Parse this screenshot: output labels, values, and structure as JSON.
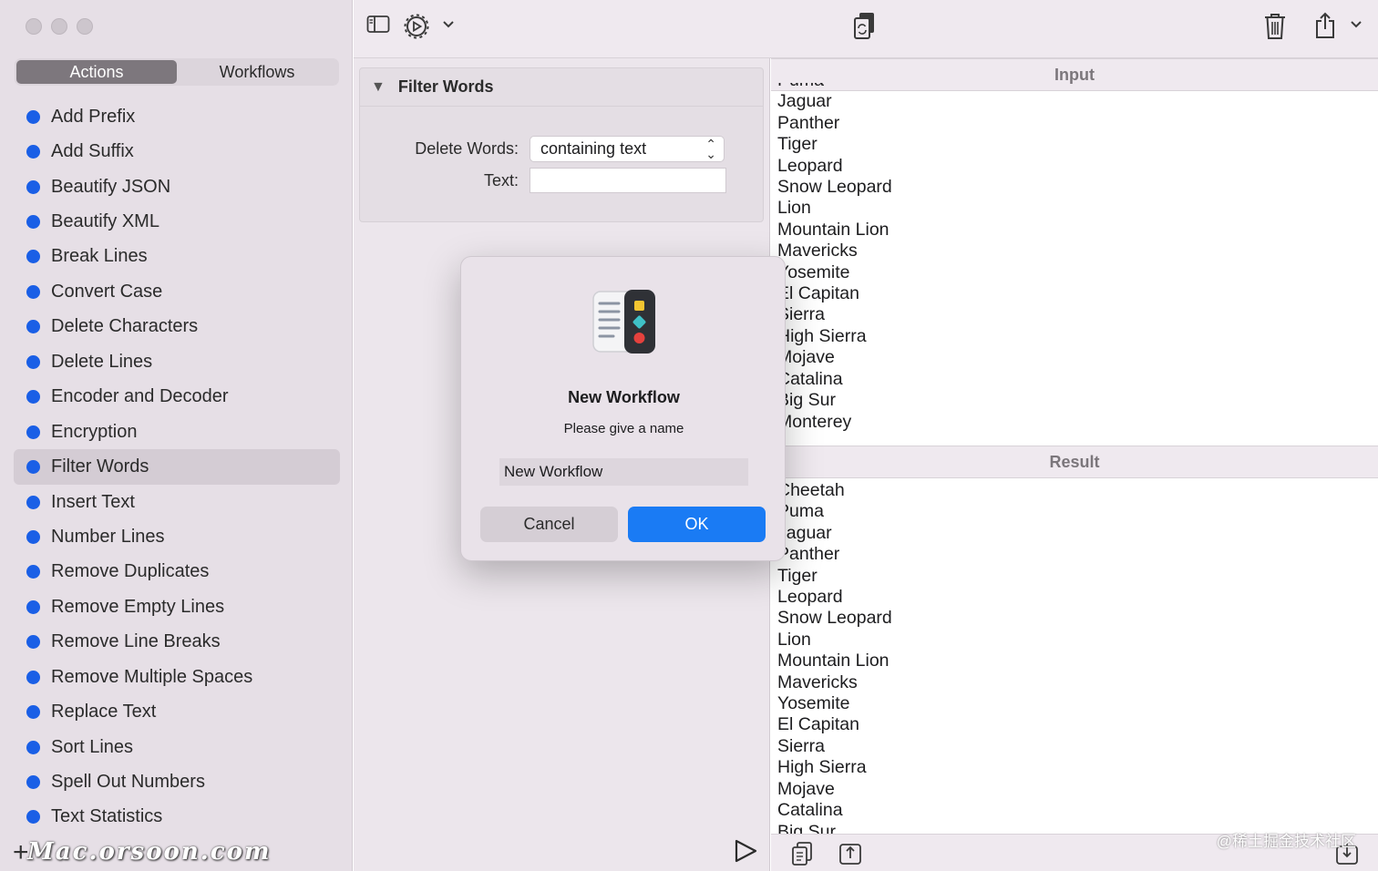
{
  "sidebar": {
    "tabs": [
      {
        "label": "Actions",
        "active": true
      },
      {
        "label": "Workflows",
        "active": false
      }
    ],
    "actions": [
      "Add Prefix",
      "Add Suffix",
      "Beautify JSON",
      "Beautify XML",
      "Break Lines",
      "Convert Case",
      "Delete Characters",
      "Delete Lines",
      "Encoder and Decoder",
      "Encryption",
      "Filter Words",
      "Insert Text",
      "Number Lines",
      "Remove Duplicates",
      "Remove Empty Lines",
      "Remove Line Breaks",
      "Remove Multiple Spaces",
      "Replace Text",
      "Sort Lines",
      "Spell Out Numbers",
      "Text Statistics"
    ],
    "selected_action": "Filter Words",
    "add_label": "+",
    "watermark": "Mac.orsoon.com"
  },
  "action_card": {
    "title": "Filter Words",
    "delete_words_label": "Delete Words:",
    "delete_words_value": "containing text",
    "text_label": "Text:",
    "text_value": ""
  },
  "input_panel": {
    "title": "Input",
    "lines": [
      "Puma",
      "Jaguar",
      "Panther",
      "Tiger",
      "Leopard",
      "Snow Leopard",
      "Lion",
      "Mountain Lion",
      "Mavericks",
      "Yosemite",
      "El Capitan",
      "Sierra",
      "High Sierra",
      "Mojave",
      "Catalina",
      "Big Sur",
      "Monterey"
    ]
  },
  "result_panel": {
    "title": "Result",
    "lines": [
      "Cheetah",
      "Puma",
      "Jaguar",
      "Panther",
      "Tiger",
      "Leopard",
      "Snow Leopard",
      "Lion",
      "Mountain Lion",
      "Mavericks",
      "Yosemite",
      "El Capitan",
      "Sierra",
      "High Sierra",
      "Mojave",
      "Catalina",
      "Big Sur"
    ]
  },
  "bottom_watermark": "@稀土掘金技术社区",
  "dialog": {
    "title": "New Workflow",
    "message": "Please give a name",
    "input_value": "New Workflow",
    "cancel_label": "Cancel",
    "ok_label": "OK"
  },
  "colors": {
    "accent": "#1a7bf4",
    "bullet": "#1a5fe6",
    "sidebar_bg": "#e6dfe6"
  },
  "icons": [
    "sidebar-toggle-icon",
    "gear-run-icon",
    "chevron-down-icon",
    "copy-sync-icon",
    "trash-icon",
    "share-icon",
    "play-icon",
    "copy-icon",
    "export-icon",
    "import-icon"
  ]
}
